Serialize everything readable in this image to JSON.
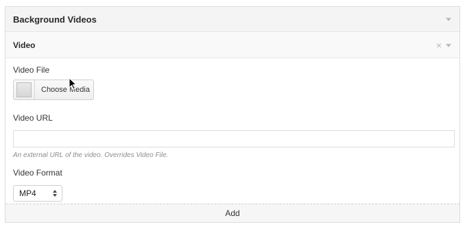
{
  "panel": {
    "title": "Background Videos"
  },
  "item": {
    "title": "Video",
    "close_icon": "×"
  },
  "fields": {
    "video_file": {
      "label": "Video File",
      "button_label": "Choose Media"
    },
    "video_url": {
      "label": "Video URL",
      "value": "",
      "help": "An external URL of the video. Overrides Video File."
    },
    "video_format": {
      "label": "Video Format",
      "selected": "MP4"
    }
  },
  "actions": {
    "add_label": "Add"
  }
}
